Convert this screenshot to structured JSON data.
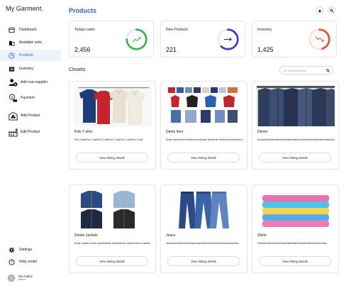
{
  "app": {
    "brand": "My Garment."
  },
  "sidebar": {
    "items": [
      {
        "label": "Dashboard",
        "icon": "grid-icon"
      },
      {
        "label": "Available units",
        "icon": "building-icon"
      },
      {
        "label": "Products",
        "icon": "clock-icon",
        "active": true
      },
      {
        "label": "Inventory",
        "icon": "list-icon"
      },
      {
        "label": "Add new supplier",
        "icon": "add-person-icon"
      },
      {
        "label": "Payment",
        "icon": "money-icon"
      },
      {
        "label": "Add Product",
        "icon": "warehouse-icon"
      },
      {
        "label": "Edit Product",
        "icon": "factory-icon"
      }
    ],
    "bottom": [
      {
        "label": "Settings",
        "icon": "gear-icon"
      },
      {
        "label": "Help center",
        "icon": "help-icon"
      }
    ],
    "profile": {
      "name": "SK Fabric",
      "role": "admin"
    }
  },
  "header": {
    "title": "Products"
  },
  "stats": [
    {
      "label": "Todays sales",
      "value": "2,456",
      "progress": 0.75,
      "color": "#3cb44b",
      "icon": "trending-up-icon"
    },
    {
      "label": "New Products",
      "value": "221",
      "progress": 0.62,
      "color": "#4338ca",
      "icon": "arrow-right-icon"
    },
    {
      "label": "Inventory",
      "value": "1,425",
      "progress": 0.45,
      "color": "#e0533d",
      "icon": "trending-down-icon"
    }
  ],
  "closets": {
    "title": "Closets",
    "search_placeholder": "Ex: Most Purchase",
    "button_label": "View listing details",
    "items": [
      {
        "name": "Polo T-shirt",
        "desc": "Polo T-shirtPolo T-shirtPolo T-shirtPolo T-shirtPolo T-shirtPolo T-shirt",
        "image": "polo-shirts-image"
      },
      {
        "name": "Dento Item",
        "desc": "Denim itemDenim ItemDenim ItemDenim ItemDenim ItemDenim ItemDenim ItemDenim",
        "image": "mixed-garments-image"
      },
      {
        "name": "Denim",
        "desc": "DenimDenimDenimDenimDenimDenimDenimDenimDenimDenimDenimDenim",
        "image": "denim-jackets-rack-image"
      },
      {
        "name": "Denim Jackets",
        "desc": "Denim Jackets Denim JacketsDenim JacketsDenim Jackets Denim Jackets",
        "image": "denim-jackets-image"
      },
      {
        "name": "Jeans",
        "desc": "JeansJeansJeansJeansJeansJeansJeansJeansJeansJeansJeansJeans",
        "image": "jeans-image"
      },
      {
        "name": "Shirts",
        "desc": "ShirtsShirtsShirtsShirtsShirtsShirtsShirtsShirtsShirtsShirtsShirtsShirts",
        "image": "folded-shirts-image"
      }
    ]
  }
}
